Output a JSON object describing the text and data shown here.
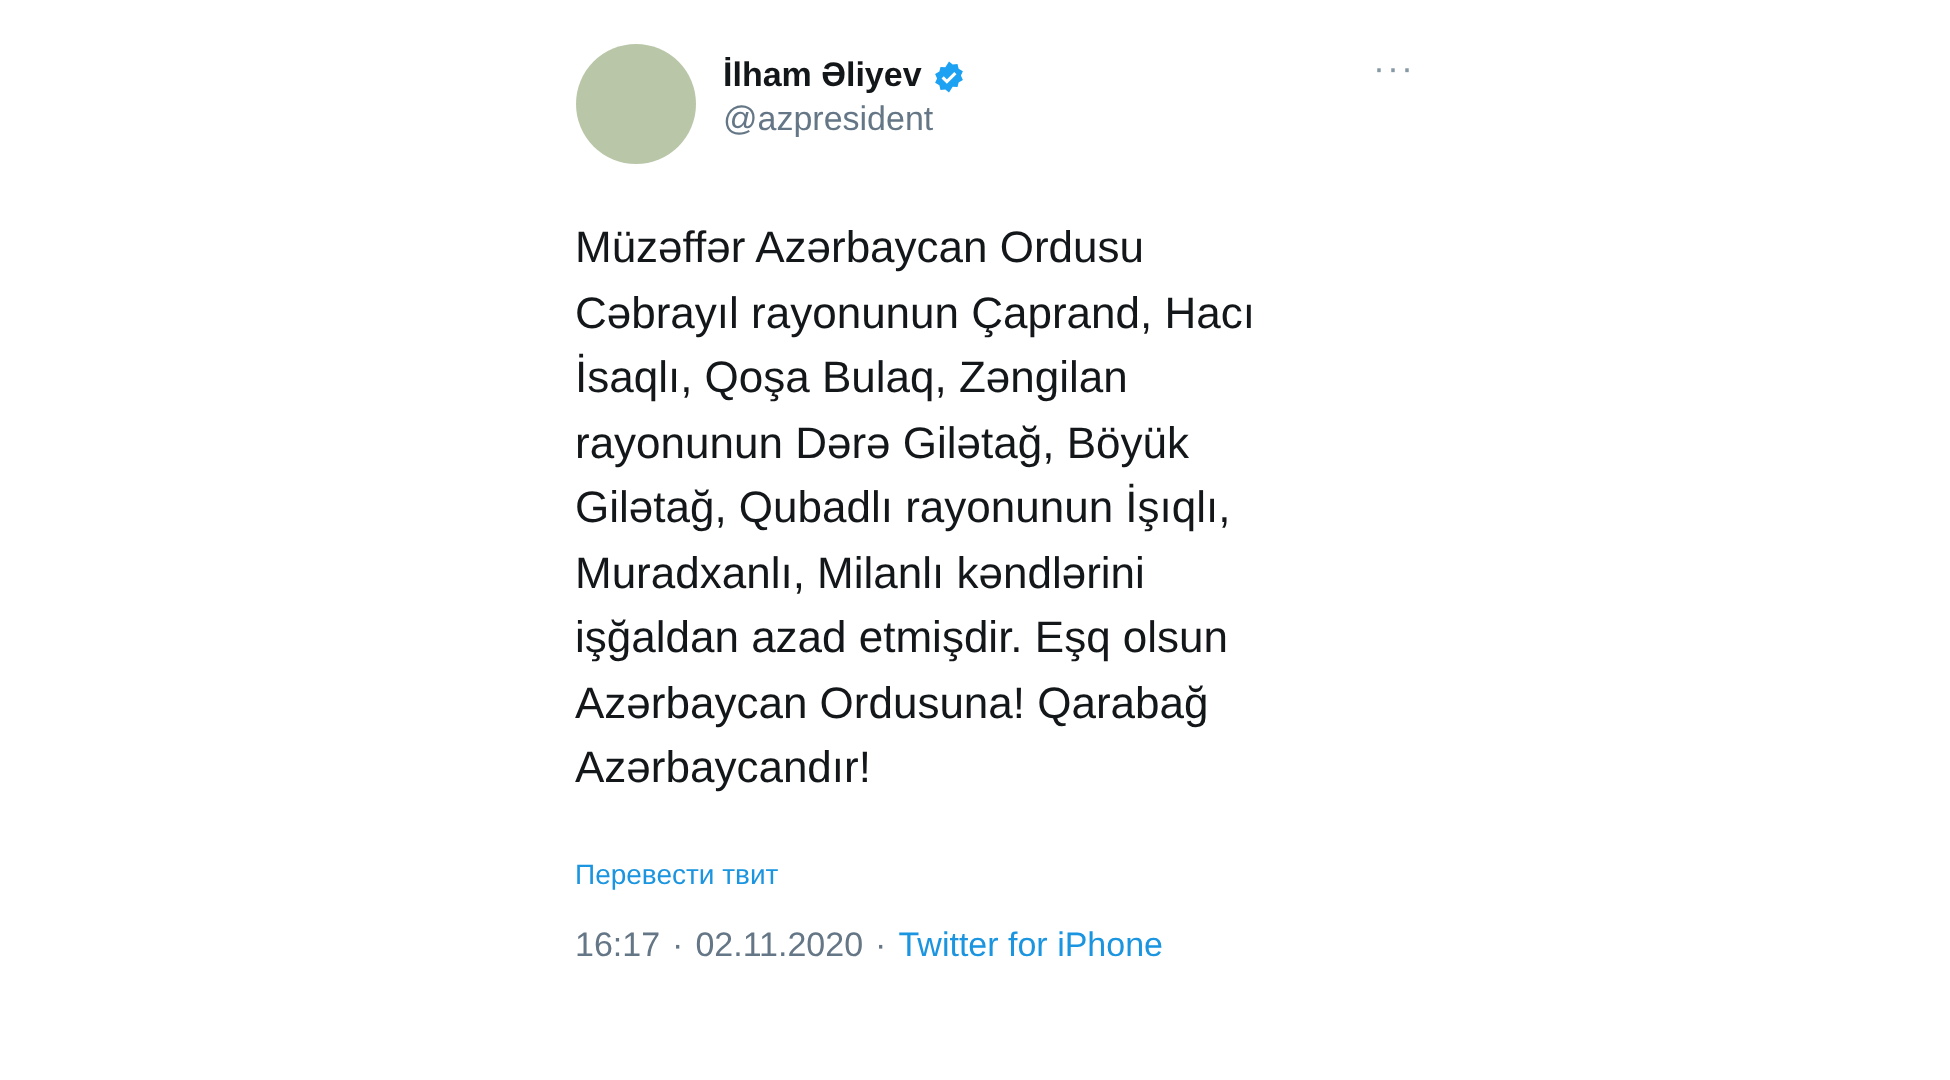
{
  "tweet": {
    "author": {
      "name": "İlham Əliyev",
      "verified": true,
      "handle": "@azpresident"
    },
    "more": "···",
    "text": "Müzəffər Azərbaycan Ordusu Cəbrayıl rayonunun Çaprand, Hacı İsaqlı, Qoşa Bulaq, Zəngilan rayonunun Dərə Gilətağ, Böyük Gilətağ, Qubadlı rayonunun İşıqlı, Muradxanlı, Milanlı kəndlərini işğaldan azad etmişdir. Eşq olsun Azərbaycan Ordusuna! Qarabağ Azərbaycandır!",
    "translate": "Перевести твит",
    "separators": [
      "·",
      "·"
    ],
    "time": "16:17",
    "date": "02.11.2020",
    "source": "Twitter for iPhone"
  }
}
